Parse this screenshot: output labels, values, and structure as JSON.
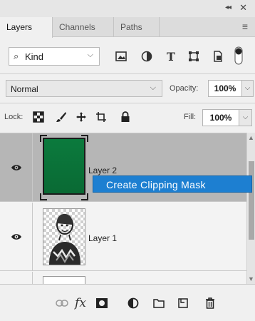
{
  "header": {
    "collapse_glyph": "◂◂",
    "close_glyph": "✕"
  },
  "tabs": [
    {
      "label": "Layers",
      "active": true
    },
    {
      "label": "Channels",
      "active": false
    },
    {
      "label": "Paths",
      "active": false
    }
  ],
  "filter": {
    "kind_label": "Kind",
    "chevron": "⌵"
  },
  "blend": {
    "mode": "Normal",
    "opacity_label": "Opacity:",
    "opacity_value": "100%"
  },
  "lock": {
    "label": "Lock:",
    "fill_label": "Fill:",
    "fill_value": "100%"
  },
  "layers": [
    {
      "name": "Layer 2",
      "visible": true,
      "selected": true,
      "thumb": "green"
    },
    {
      "name": "Layer 1",
      "visible": true,
      "selected": false,
      "thumb": "transparent-photo"
    },
    {
      "name": "",
      "visible": false,
      "selected": false,
      "thumb": "white"
    }
  ],
  "context_menu": {
    "item": "Create Clipping Mask",
    "highlight_color": "#1d7fd1"
  },
  "icons": {
    "filter_icons": [
      "search-icon",
      "pixel-layer-filter-icon",
      "adjustment-layer-filter-icon",
      "type-layer-filter-icon",
      "shape-layer-filter-icon",
      "smart-object-filter-icon",
      "filter-toggle-icon"
    ],
    "lock_icons": [
      "lock-transparent-pixels-icon",
      "lock-image-pixels-icon",
      "lock-position-icon",
      "lock-artboard-icon",
      "lock-all-icon"
    ],
    "bottom_icons": [
      "link-layers-icon",
      "fx-icon",
      "add-mask-icon",
      "new-adjustment-layer-icon",
      "new-group-icon",
      "new-layer-icon",
      "delete-layer-icon"
    ]
  },
  "colors": {
    "panel_bg": "#f0f0f0",
    "selected_row": "#b6b6b6",
    "layer2_fill": "#0b7a3d",
    "menu_highlight": "#1d7fd1"
  }
}
